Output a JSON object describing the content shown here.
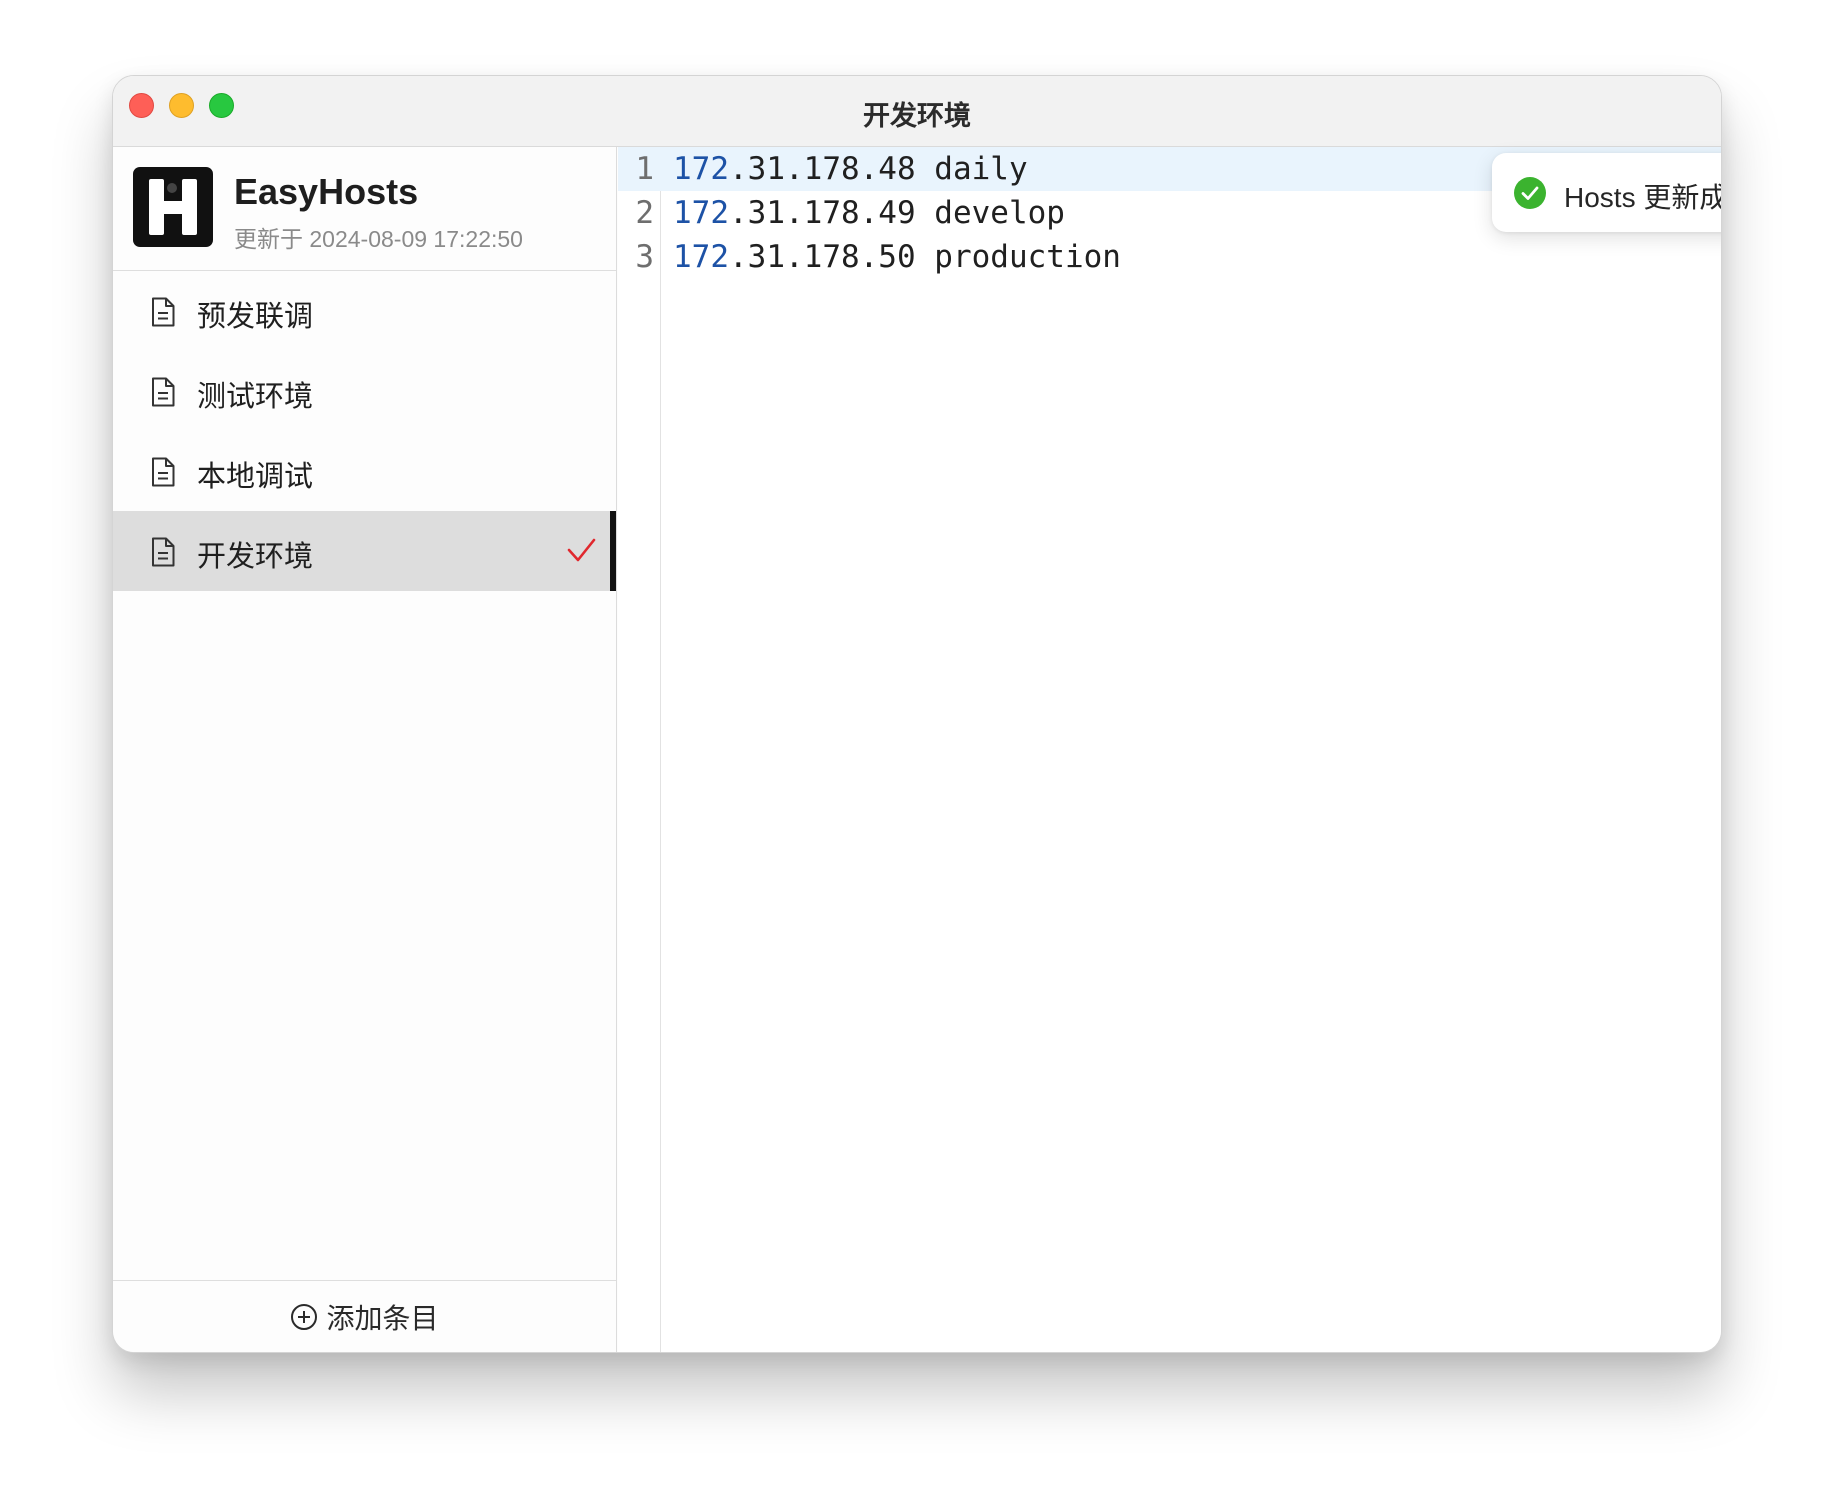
{
  "window": {
    "title": "开发环境"
  },
  "app": {
    "name": "EasyHosts",
    "updated": "更新于 2024-08-09 17:22:50"
  },
  "sidebar": {
    "items": [
      {
        "label": "预发联调",
        "icon": "document-icon",
        "selected": false
      },
      {
        "label": "测试环境",
        "icon": "document-icon",
        "selected": false
      },
      {
        "label": "本地调试",
        "icon": "document-icon",
        "selected": false
      },
      {
        "label": "开发环境",
        "icon": "document-icon",
        "selected": true
      }
    ],
    "add_label": "添加条目"
  },
  "editor": {
    "lines": [
      {
        "number": "1",
        "ip_head": "172",
        "ip_tail": ".31.178.48",
        "host": " daily"
      },
      {
        "number": "2",
        "ip_head": "172",
        "ip_tail": ".31.178.49",
        "host": " develop"
      },
      {
        "number": "3",
        "ip_head": "172",
        "ip_tail": ".31.178.50",
        "host": " production"
      }
    ]
  },
  "toast": {
    "message": "Hosts 更新成功",
    "icon": "success-check-icon"
  },
  "colors": {
    "close": "#fe5f57",
    "minimize": "#febc2e",
    "zoom": "#28c840",
    "check_mark": "#e0282e",
    "success": "#3bb32f",
    "ip_accent": "#1d52a6",
    "active_line": "#e9f4fd",
    "selected_item": "#dddddd"
  }
}
